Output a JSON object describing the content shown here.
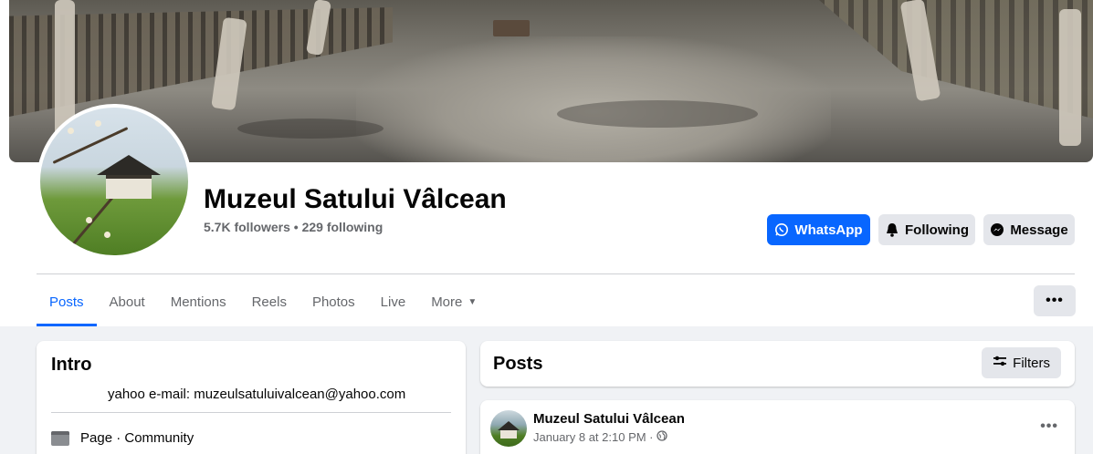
{
  "page": {
    "name": "Muzeul Satului Vâlcean",
    "stats": "5.7K followers • 229 following"
  },
  "actions": {
    "whatsapp": "WhatsApp",
    "following": "Following",
    "message": "Message",
    "more_dots": "•••"
  },
  "tabs": [
    {
      "label": "Posts",
      "active": true
    },
    {
      "label": "About"
    },
    {
      "label": "Mentions"
    },
    {
      "label": "Reels"
    },
    {
      "label": "Photos"
    },
    {
      "label": "Live"
    },
    {
      "label": "More"
    }
  ],
  "intro": {
    "title": "Intro",
    "bio": "yahoo e-mail: muzeulsatuluivalcean@yahoo.com",
    "category": "Page · Community"
  },
  "posts": {
    "title": "Posts",
    "filters_label": "Filters",
    "first_post": {
      "author": "Muzeul Satului Vâlcean",
      "time": "January 8 at 2:10 PM ·"
    }
  },
  "colors": {
    "accent": "#0866ff",
    "secondary_button": "#e4e6eb",
    "feed_background": "#f0f2f5",
    "muted_text": "#65676b"
  }
}
